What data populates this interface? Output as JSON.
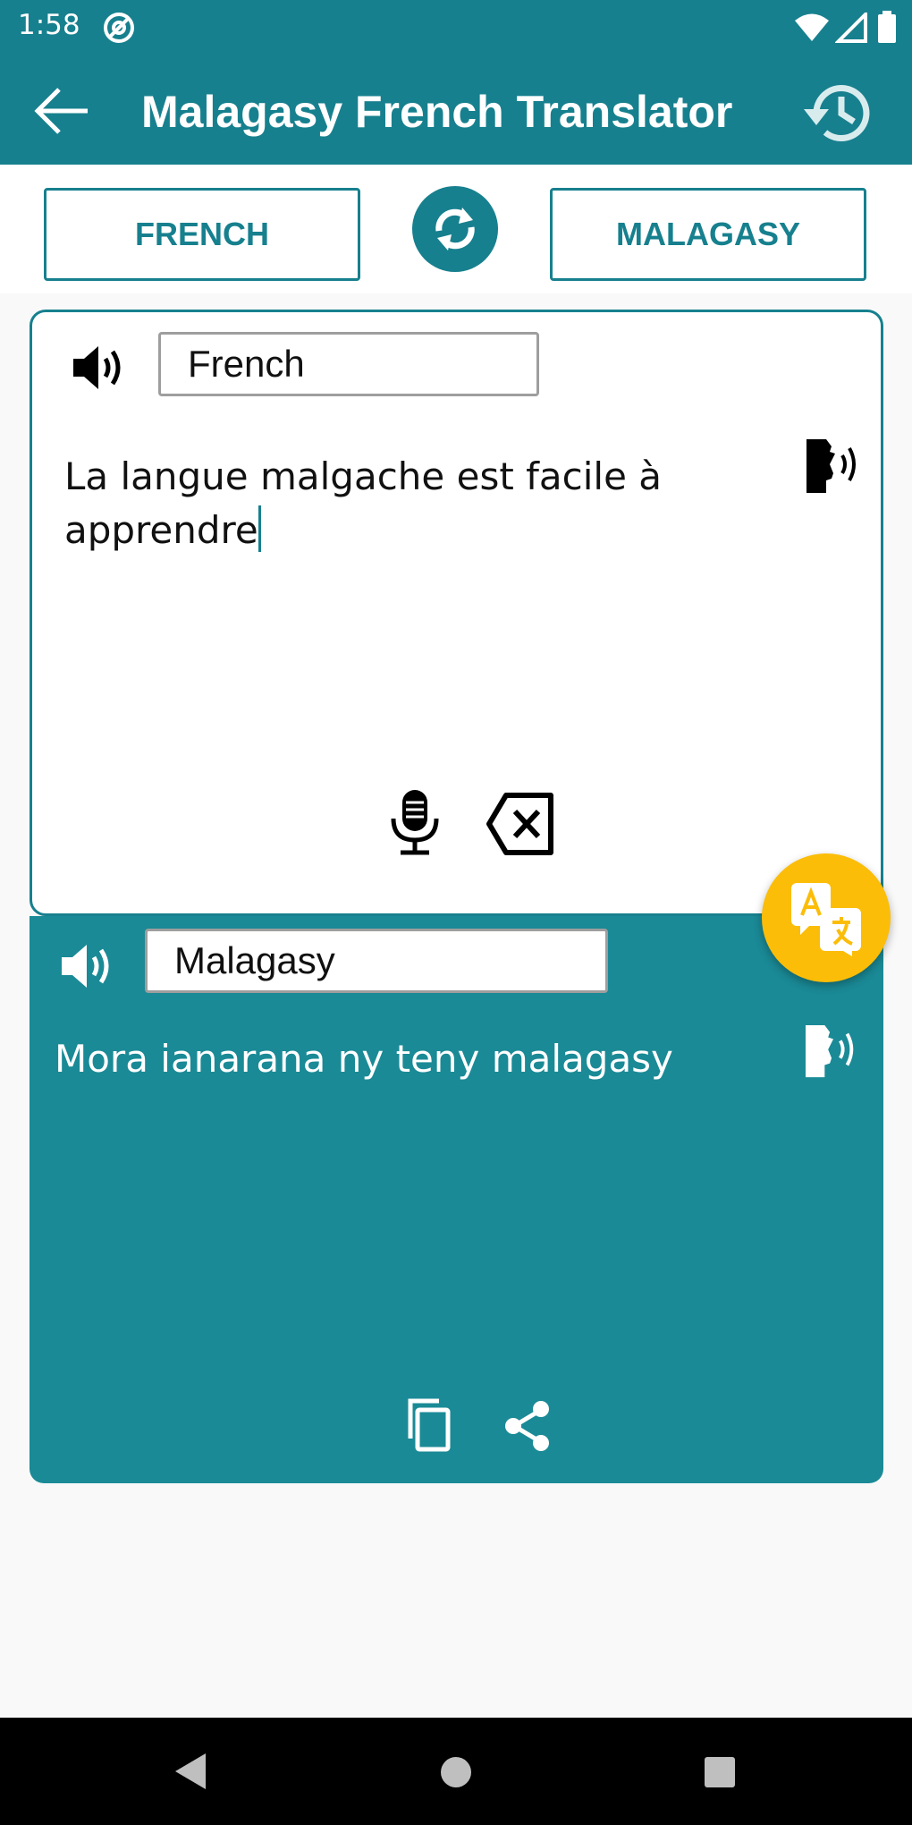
{
  "status_bar": {
    "time": "1:58"
  },
  "app_bar": {
    "title": "Malagasy French Translator"
  },
  "languages": {
    "source": "FRENCH",
    "target": "MALAGASY"
  },
  "source_panel": {
    "language_field": "French",
    "text": "La langue malgache est facile à apprendre"
  },
  "target_panel": {
    "language_field": "Malagasy",
    "text": "Mora ianarana ny teny malagasy"
  },
  "colors": {
    "primary": "#17808e",
    "panel": "#1a8a96",
    "accent": "#fbbd08"
  },
  "icons": [
    "arrow-left-icon",
    "history-icon",
    "swap-icon",
    "speaker-icon",
    "voice-speak-icon",
    "microphone-icon",
    "backspace-icon",
    "translate-icon",
    "copy-icon",
    "share-icon"
  ]
}
